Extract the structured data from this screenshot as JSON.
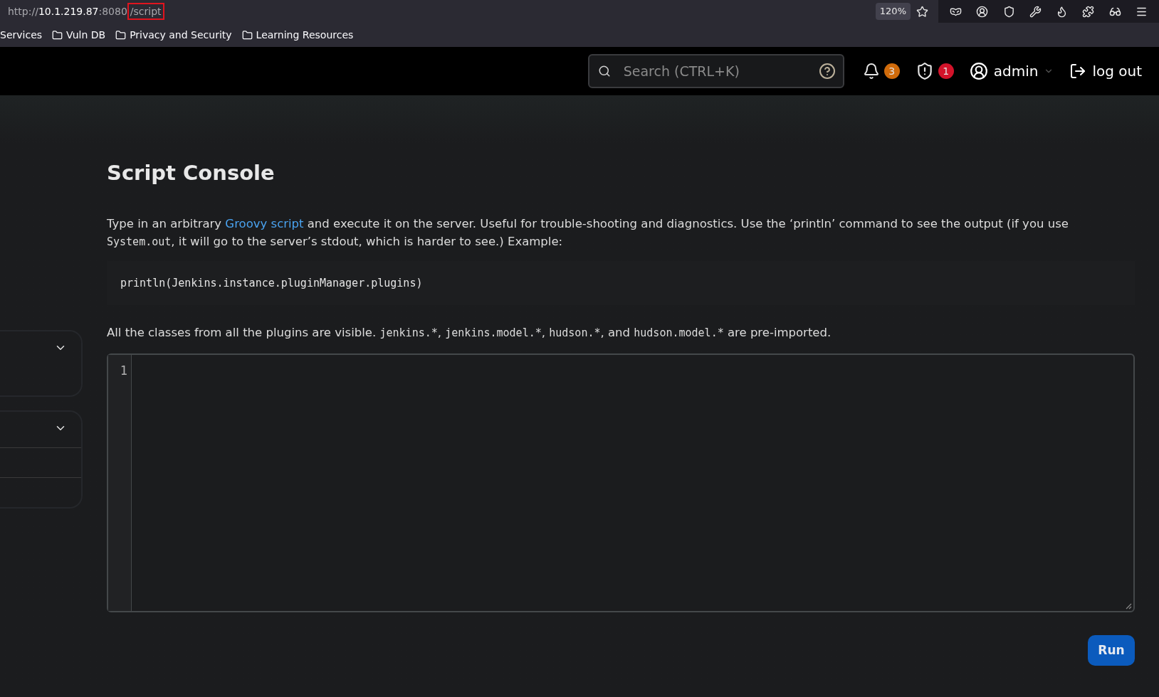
{
  "browser": {
    "url": {
      "scheme": "http://",
      "host": "10.1.219.87",
      "port": ":8080",
      "path": "/script"
    },
    "zoom": "120%"
  },
  "bookmarks": [
    {
      "label": "Services",
      "kind": "link"
    },
    {
      "label": "Vuln DB",
      "kind": "folder"
    },
    {
      "label": "Privacy and Security",
      "kind": "folder"
    },
    {
      "label": "Learning Resources",
      "kind": "folder"
    }
  ],
  "header": {
    "search": {
      "placeholder": "Search (CTRL+K)"
    },
    "notifications": "3",
    "security": "1",
    "user": "admin",
    "logout": "log out"
  },
  "side_panels": [
    {
      "kind": "plain"
    },
    {
      "kind": "rows"
    }
  ],
  "page": {
    "title": "Script Console",
    "intro": [
      {
        "kind": "text",
        "text": "Type in an arbitrary "
      },
      {
        "kind": "link",
        "text": "Groovy script"
      },
      {
        "kind": "text",
        "text": " and execute it on the server. Useful for trouble-shooting and diagnostics. Use the ‘println’ command to see the output (if you use "
      },
      {
        "kind": "code",
        "text": "System.out"
      },
      {
        "kind": "text",
        "text": ", it will go to the server’s stdout, which is harder to see.) Example:"
      }
    ],
    "example": "println(Jenkins.instance.pluginManager.plugins)",
    "note": [
      {
        "kind": "text",
        "text": "All the classes from all the plugins are visible. "
      },
      {
        "kind": "code",
        "text": "jenkins.*"
      },
      {
        "kind": "text",
        "text": ", "
      },
      {
        "kind": "code",
        "text": "jenkins.model.*"
      },
      {
        "kind": "text",
        "text": ", "
      },
      {
        "kind": "code",
        "text": "hudson.*"
      },
      {
        "kind": "text",
        "text": ", and "
      },
      {
        "kind": "code",
        "text": "hudson.model.*"
      },
      {
        "kind": "text",
        "text": " are pre-imported."
      }
    ],
    "editor": {
      "line_numbers": [
        "1"
      ]
    },
    "run_button": "Run"
  }
}
